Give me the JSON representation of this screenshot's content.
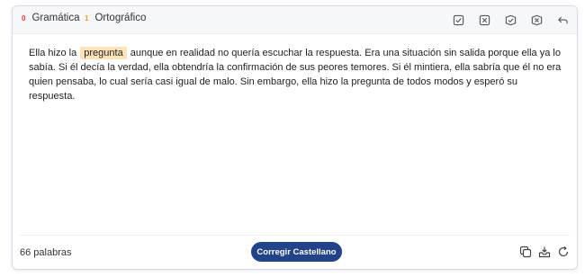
{
  "tabs": [
    {
      "count": "0",
      "label": "Gramática"
    },
    {
      "count": "1",
      "label": "Ortográfico"
    }
  ],
  "toolbar": {
    "icons": [
      "check-square-icon",
      "x-square-icon",
      "check-circle-icon",
      "x-circle-icon",
      "undo-icon"
    ]
  },
  "text": {
    "before": "Ella hizo la",
    "highlight": "pregunta",
    "after": "aunque en realidad no quería escuchar la respuesta. Era una situación sin salida porque ella ya lo sabía. Si él decía la verdad, ella obtendría la confirmación de sus peores temores. Si él mintiera, ella sabría que él no era quien pensaba, lo cual sería casi igual de malo. Sin embargo, ella hizo la pregunta de todos modos y esperó su respuesta."
  },
  "footer": {
    "word_count": "66 palabras",
    "button_label": "Corregir Castellano",
    "icons": [
      "copy-icon",
      "download-tray-icon",
      "reload-icon"
    ]
  },
  "colors": {
    "accent": "#22428a",
    "highlight": "#fde3b8",
    "grammar_count": "#e53935",
    "spelling_count": "#f0a020"
  }
}
